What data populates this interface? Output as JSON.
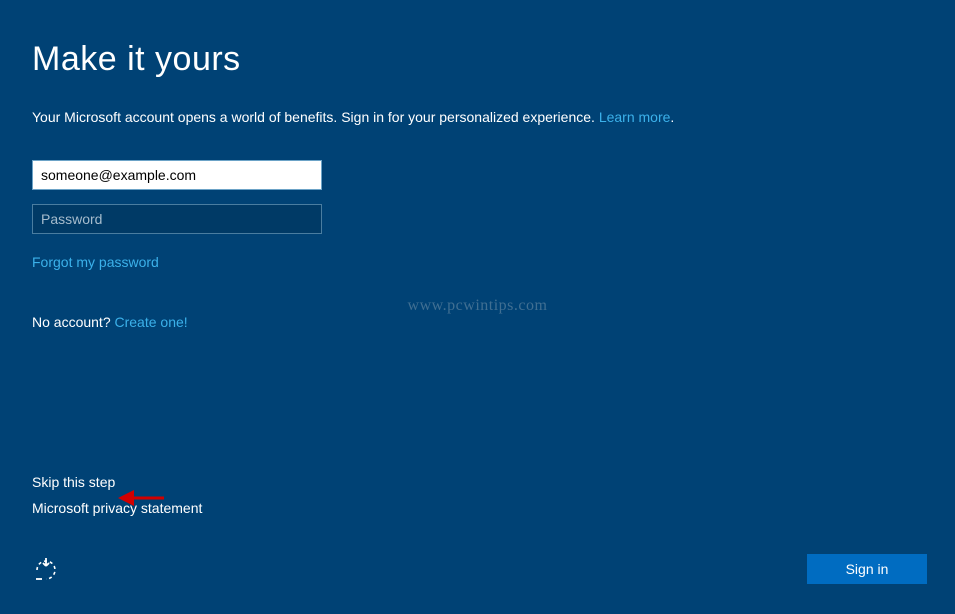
{
  "header": {
    "title": "Make it yours"
  },
  "description": {
    "text": "Your Microsoft account opens a world of benefits. Sign in for your personalized experience. ",
    "learn_more": "Learn more"
  },
  "form": {
    "email_value": "someone@example.com",
    "password_placeholder": "Password",
    "forgot_password": "Forgot my password",
    "no_account_text": "No account? ",
    "create_one": "Create one!"
  },
  "watermark": {
    "text": "www.pcwintips.com"
  },
  "bottom": {
    "skip_step": "Skip this step",
    "privacy_statement": "Microsoft privacy statement"
  },
  "buttons": {
    "signin": "Sign in"
  }
}
